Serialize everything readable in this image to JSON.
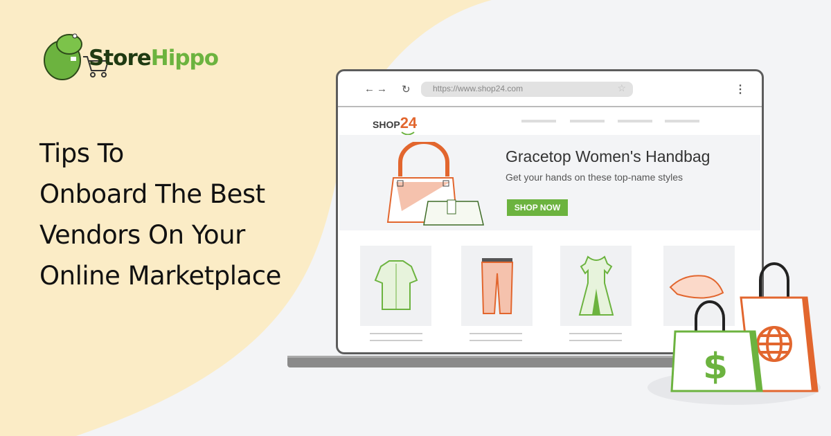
{
  "brand": {
    "name_part1": "Store",
    "name_part2": "Hippo",
    "colors": {
      "dark": "#1f3a12",
      "green": "#6cb33f",
      "cream": "#fbecc6",
      "orange": "#e2662e"
    }
  },
  "headline": {
    "lines": [
      "Tips To",
      "Onboard The Best",
      "Vendors On Your",
      "Online Marketplace"
    ]
  },
  "browser": {
    "url": "https://www.shop24.com",
    "back_icon": "arrow-left-icon",
    "forward_icon": "arrow-right-icon",
    "reload_icon": "reload-icon",
    "star_icon": "star-icon",
    "menu_icon": "kebab-menu-icon"
  },
  "shop": {
    "logo_text": "SHOP",
    "logo_number": "24",
    "hero": {
      "title": "Gracetop Women's Handbag",
      "subtitle": "Get your hands on these top-name styles",
      "button": "SHOP NOW"
    },
    "products": [
      {
        "icon": "shirt-icon"
      },
      {
        "icon": "trousers-icon"
      },
      {
        "icon": "dress-icon"
      },
      {
        "icon": "hat-icon"
      }
    ]
  },
  "bags": [
    {
      "icon": "dollar-icon"
    },
    {
      "icon": "globe-icon"
    }
  ]
}
